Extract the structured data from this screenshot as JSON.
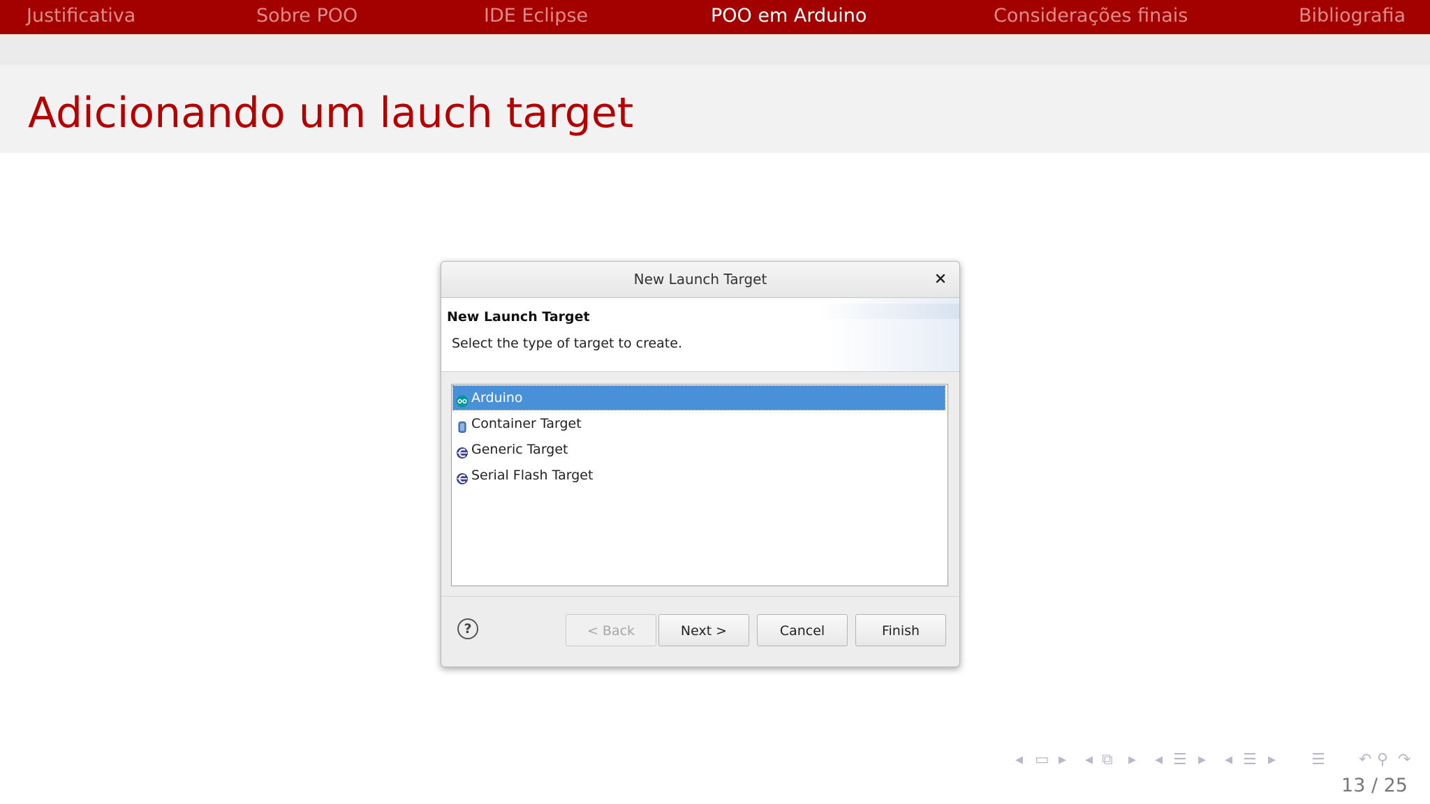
{
  "nav": {
    "items": [
      {
        "label": "Justificativa",
        "active": false
      },
      {
        "label": "Sobre POO",
        "active": false
      },
      {
        "label": "IDE Eclipse",
        "active": false
      },
      {
        "label": "POO em Arduino",
        "active": true
      },
      {
        "label": "Considerações finais",
        "active": false
      },
      {
        "label": "Bibliografia",
        "active": false
      }
    ]
  },
  "slide": {
    "title": "Adicionando um lauch target",
    "page": "13 / 25"
  },
  "dialog": {
    "title": "New Launch Target",
    "close_icon": "close-icon",
    "heading": "New Launch Target",
    "description": "Select the type of target to create.",
    "targets": [
      {
        "label": "Arduino",
        "icon": "arduino-icon",
        "selected": true
      },
      {
        "label": "Container Target",
        "icon": "container-icon",
        "selected": false
      },
      {
        "label": "Generic Target",
        "icon": "eclipse-cdt-icon",
        "selected": false
      },
      {
        "label": "Serial Flash Target",
        "icon": "eclipse-cdt-icon",
        "selected": false
      }
    ],
    "buttons": {
      "back": "< Back",
      "next": "Next >",
      "cancel": "Cancel",
      "finish": "Finish"
    },
    "help_glyph": "?"
  },
  "colors": {
    "nav_bg": "#a30000",
    "title_color": "#b30000",
    "selection": "#4a90d9"
  }
}
